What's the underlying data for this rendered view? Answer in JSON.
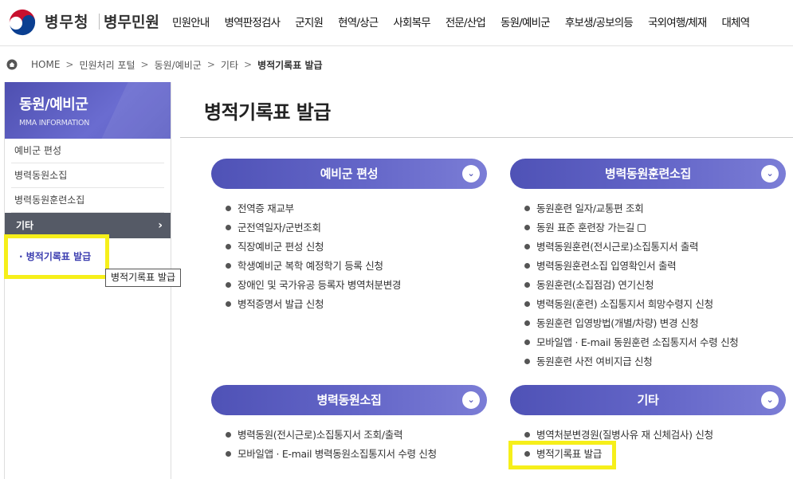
{
  "header": {
    "brand": "병무청",
    "brand_sub": "병무민원",
    "gnb": [
      "민원안내",
      "병역판정검사",
      "군지원",
      "현역/상근",
      "사회복무",
      "전문/산업",
      "동원/예비군",
      "후보생/공보의등",
      "국외여행/체재",
      "대체역"
    ]
  },
  "breadcrumb": [
    "HOME",
    "민원처리 포털",
    "동원/예비군",
    "기타",
    "병적기록표 발급"
  ],
  "sidebar": {
    "title": "동원/예비군",
    "subtitle": "MMA INFORMATION",
    "items": [
      "예비군 편성",
      "병력동원소집",
      "병력동원훈련소집"
    ],
    "active": "기타",
    "active_chevron": "›",
    "subitem": "· 병적기록표 발급",
    "tooltip": "병적기록표 발급"
  },
  "main": {
    "title": "병적기록표 발급",
    "sections": [
      {
        "title": "예비군 편성",
        "toggle": "⌄",
        "items": [
          "전역증 재교부",
          "군전역일자/군번조회",
          "직장예비군 편성 신청",
          "학생예비군 복학 예정학기 등록 신청",
          "장애인 및 국가유공 등록자 병역처분변경",
          "병적증명서 발급 신청"
        ]
      },
      {
        "title": "병력동원훈련소집",
        "toggle": "⌄",
        "items": [
          "동원훈련 일자/교통편 조회",
          "동원 표준 훈련장 가는길",
          "병력동원훈련(전시근로)소집통지서 출력",
          "병력동원훈련소집 입영확인서 출력",
          "동원훈련(소집점검) 연기신청",
          "병력동원(훈련) 소집통지서 희망수령지 신청",
          "동원훈련 입영방법(개별/차량) 변경 신청",
          "모바일앱 · E-mail 동원훈련 소집통지서 수령 신청",
          "동원훈련 사전 여비지급 신청"
        ]
      },
      {
        "title": "병력동원소집",
        "toggle": "⌄",
        "items": [
          "병력동원(전시근로)소집통지서 조회/출력",
          "모바일앱 · E-mail 병력동원소집통지서 수령 신청"
        ]
      },
      {
        "title": "기타",
        "toggle": "⌄",
        "items": [
          "병역처분변경원(질병사유 재 신체검사) 신청",
          "병적기록표 발급"
        ]
      }
    ]
  },
  "colors": {
    "accent": "#5557b8",
    "highlight": "#f6ef1a",
    "sidebar_active": "#555a66"
  }
}
